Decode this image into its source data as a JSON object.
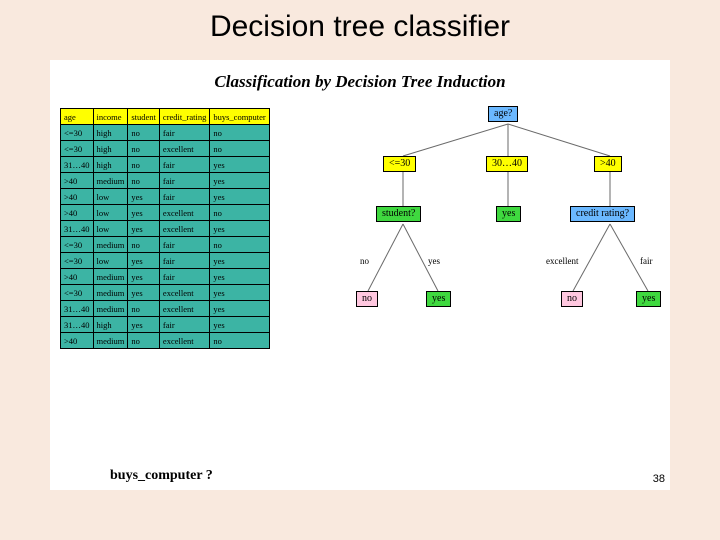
{
  "slide": {
    "title": "Decision tree classifier",
    "subtitle": "Classification by Decision Tree Induction",
    "page": "38",
    "question": "buys_computer ?"
  },
  "table": {
    "headers": [
      "age",
      "income",
      "student",
      "credit_rating",
      "buys_computer"
    ],
    "rows": [
      [
        "<=30",
        "high",
        "no",
        "fair",
        "no"
      ],
      [
        "<=30",
        "high",
        "no",
        "excellent",
        "no"
      ],
      [
        "31…40",
        "high",
        "no",
        "fair",
        "yes"
      ],
      [
        ">40",
        "medium",
        "no",
        "fair",
        "yes"
      ],
      [
        ">40",
        "low",
        "yes",
        "fair",
        "yes"
      ],
      [
        ">40",
        "low",
        "yes",
        "excellent",
        "no"
      ],
      [
        "31…40",
        "low",
        "yes",
        "excellent",
        "yes"
      ],
      [
        "<=30",
        "medium",
        "no",
        "fair",
        "no"
      ],
      [
        "<=30",
        "low",
        "yes",
        "fair",
        "yes"
      ],
      [
        ">40",
        "medium",
        "yes",
        "fair",
        "yes"
      ],
      [
        "<=30",
        "medium",
        "yes",
        "excellent",
        "yes"
      ],
      [
        "31…40",
        "medium",
        "no",
        "excellent",
        "yes"
      ],
      [
        "31…40",
        "high",
        "yes",
        "fair",
        "yes"
      ],
      [
        ">40",
        "medium",
        "no",
        "excellent",
        "no"
      ]
    ]
  },
  "tree": {
    "root": "age?",
    "branch_labels": {
      "left": "<=30",
      "mid": "30…40",
      "right": ">40"
    },
    "left_node": "student?",
    "mid_leaf": "yes",
    "right_node": "credit rating?",
    "student_branches": {
      "no": "no",
      "yes": "yes"
    },
    "student_leaves": {
      "no": "no",
      "yes": "yes"
    },
    "credit_branches": {
      "left": "excellent",
      "right": "fair"
    },
    "credit_leaves": {
      "excellent": "no",
      "fair": "yes"
    }
  }
}
